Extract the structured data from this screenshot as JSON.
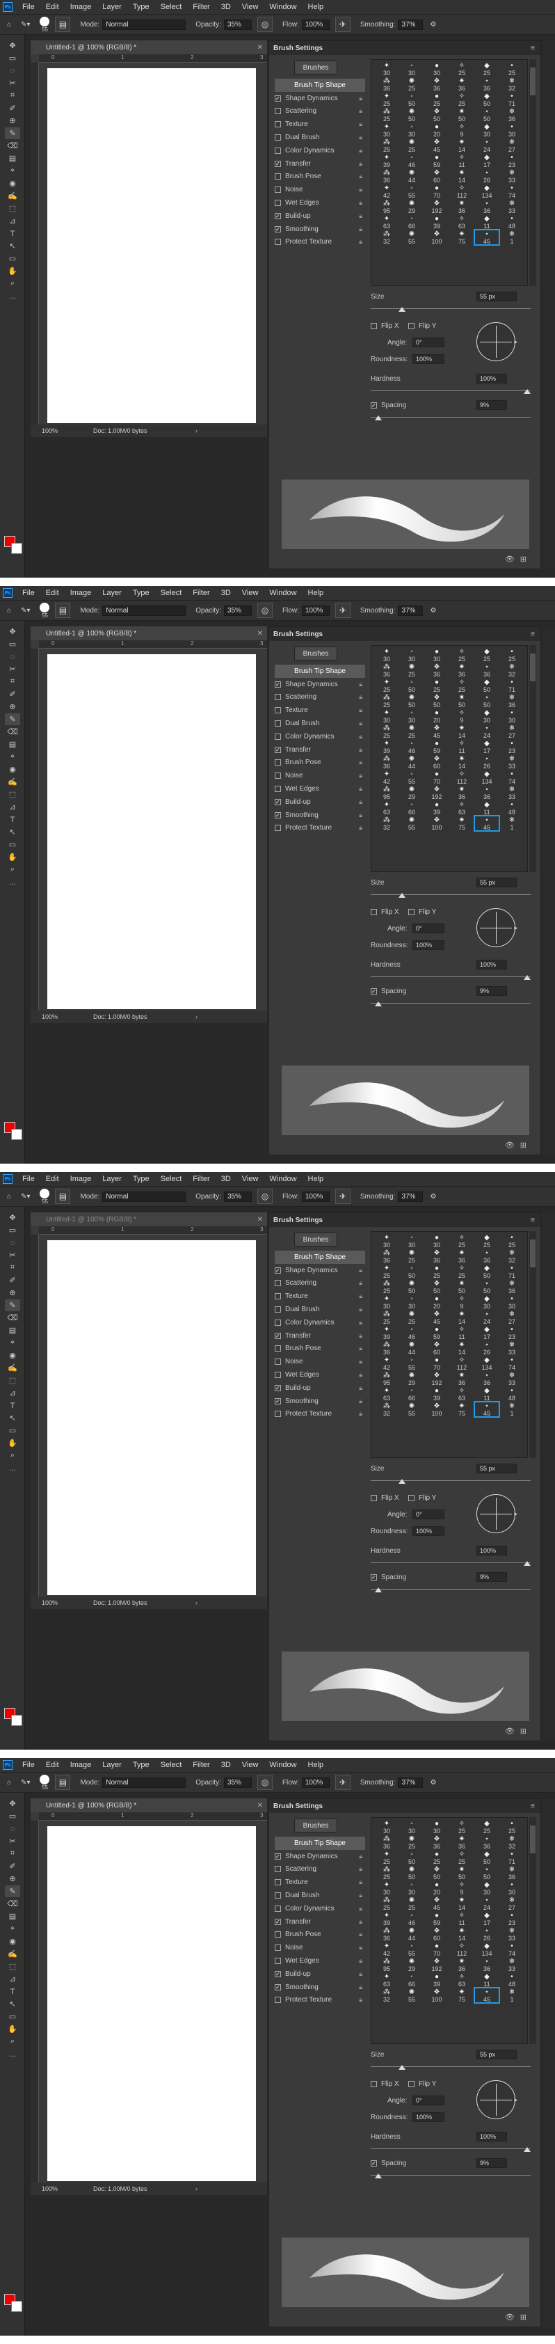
{
  "menu": [
    "File",
    "Edit",
    "Image",
    "Layer",
    "Type",
    "Select",
    "Filter",
    "3D",
    "View",
    "Window",
    "Help"
  ],
  "logo": "Ps",
  "options": {
    "brush_size": "55",
    "mode_label": "Mode:",
    "mode_value": "Normal",
    "opacity_label": "Opacity:",
    "opacity_value": "35%",
    "flow_label": "Flow:",
    "flow_value": "100%",
    "smoothing_label": "Smoothing:",
    "smoothing_value": "37%"
  },
  "document": {
    "tab_title": "Untitled-1 @ 100% (RGB/8) *",
    "zoom": "100%",
    "doc_info": "Doc: 1.00M/0 bytes",
    "ruler_marks": [
      "0",
      "1",
      "2",
      "3"
    ]
  },
  "brush_settings": {
    "title": "Brush Settings",
    "brushes_button": "Brushes",
    "options": [
      {
        "label": "Brush Tip Shape",
        "checked": null,
        "selected": true
      },
      {
        "label": "Shape Dynamics",
        "checked": true
      },
      {
        "label": "Scattering",
        "checked": false
      },
      {
        "label": "Texture",
        "checked": false
      },
      {
        "label": "Dual Brush",
        "checked": false
      },
      {
        "label": "Color Dynamics",
        "checked": false
      },
      {
        "label": "Transfer",
        "checked": true
      },
      {
        "label": "Brush Pose",
        "checked": false
      },
      {
        "label": "Noise",
        "checked": false
      },
      {
        "label": "Wet Edges",
        "checked": false
      },
      {
        "label": "Build-up",
        "checked": true
      },
      {
        "label": "Smoothing",
        "checked": true
      },
      {
        "label": "Protect Texture",
        "checked": false
      }
    ],
    "tip_sizes": [
      "30",
      "30",
      "30",
      "25",
      "25",
      "25",
      "36",
      "25",
      "36",
      "36",
      "36",
      "32",
      "25",
      "50",
      "25",
      "25",
      "50",
      "71",
      "25",
      "50",
      "50",
      "50",
      "50",
      "36",
      "30",
      "30",
      "20",
      "9",
      "30",
      "30",
      "25",
      "25",
      "45",
      "14",
      "24",
      "27",
      "39",
      "46",
      "59",
      "11",
      "17",
      "23",
      "36",
      "44",
      "60",
      "14",
      "26",
      "33",
      "42",
      "55",
      "70",
      "112",
      "134",
      "74",
      "95",
      "29",
      "192",
      "36",
      "36",
      "33",
      "63",
      "66",
      "39",
      "63",
      "11",
      "48",
      "32",
      "55",
      "100",
      "75",
      "45",
      "1"
    ],
    "size_label": "Size",
    "size_value": "55 px",
    "flip_x": "Flip X",
    "flip_y": "Flip Y",
    "angle_label": "Angle:",
    "angle_value": "0°",
    "roundness_label": "Roundness:",
    "roundness_value": "100%",
    "hardness_label": "Hardness",
    "hardness_value": "100%",
    "spacing_label": "Spacing",
    "spacing_value": "9%"
  },
  "frame_variants": [
    {
      "doc_tab_dim": false,
      "opacity": "35%"
    },
    {
      "doc_tab_dim": false,
      "opacity": "35%"
    },
    {
      "doc_tab_dim": true,
      "opacity": "35%"
    },
    {
      "doc_tab_dim": false,
      "opacity": "35%"
    }
  ],
  "accent_color": "#1e9be9",
  "foreground_color": "#e00000"
}
